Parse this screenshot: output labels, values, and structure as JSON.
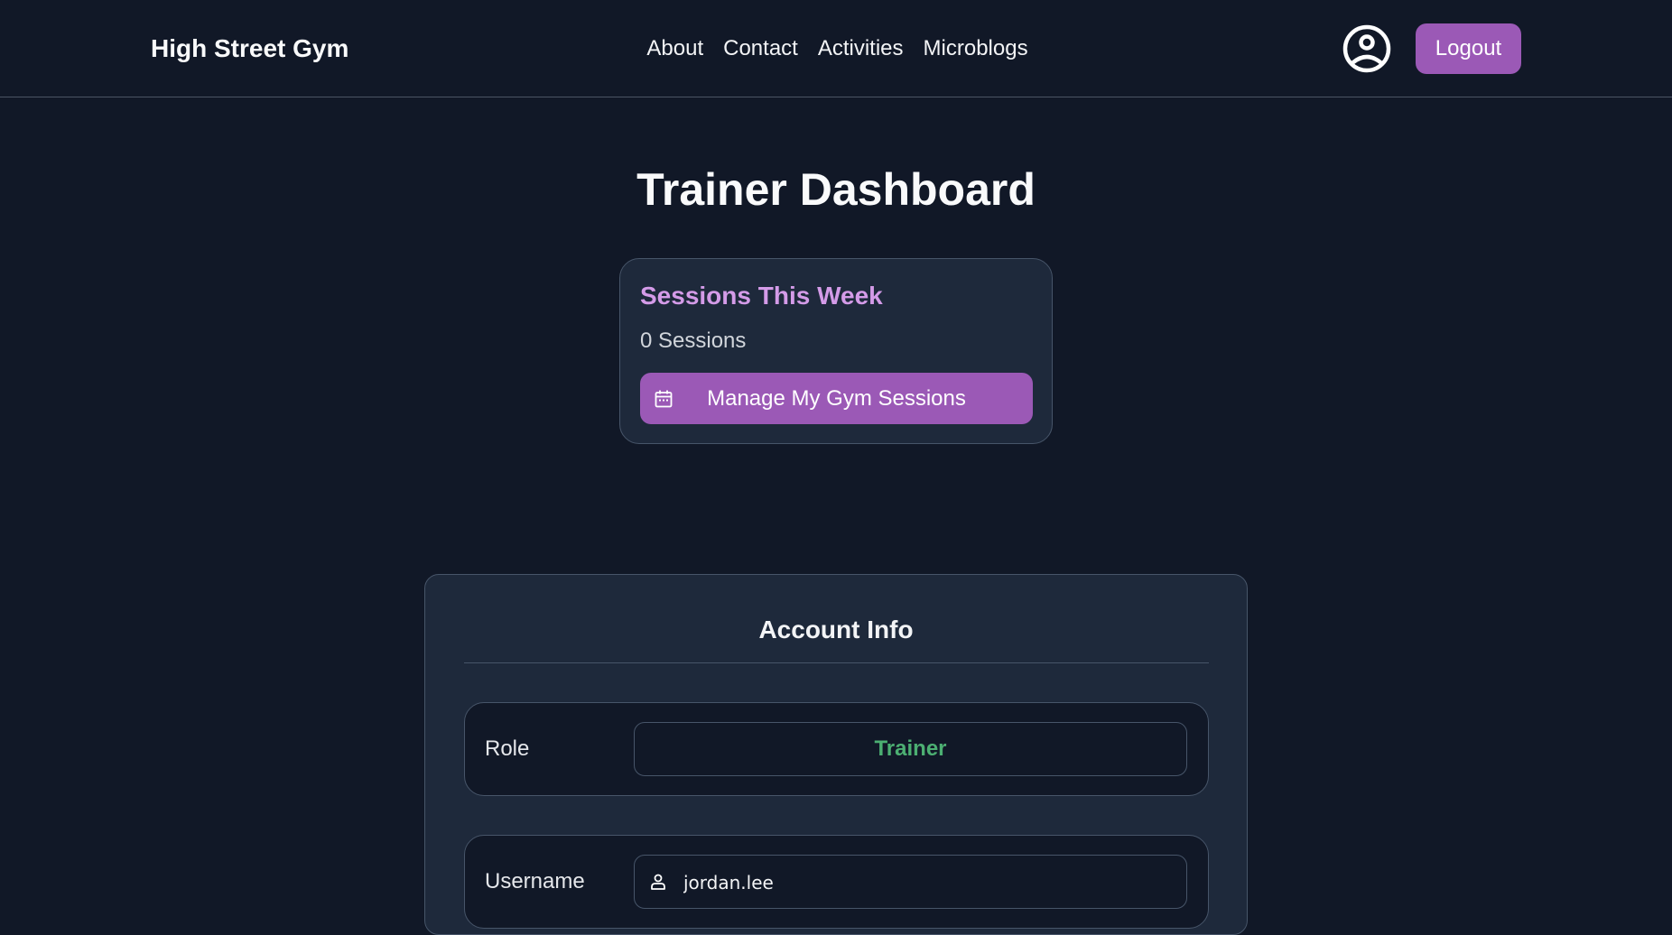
{
  "nav": {
    "brand": "High Street Gym",
    "links": [
      "About",
      "Contact",
      "Activities",
      "Microblogs"
    ],
    "logout_label": "Logout",
    "avatar_icon": "user-circle-icon"
  },
  "page": {
    "title": "Trainer Dashboard"
  },
  "sessions_card": {
    "title": "Sessions This Week",
    "count_text": "0 Sessions",
    "manage_button_label": "Manage My Gym Sessions",
    "manage_button_icon": "calendar-icon"
  },
  "account": {
    "title": "Account Info",
    "role_label": "Role",
    "role_value": "Trainer",
    "username_label": "Username",
    "username_value": "jordan.lee",
    "username_icon": "user-icon"
  },
  "colors": {
    "background": "#111827",
    "card": "#1e293b",
    "accent": "#9b59b6",
    "sessions_title": "#d49be8",
    "role_value": "#4caf72"
  }
}
